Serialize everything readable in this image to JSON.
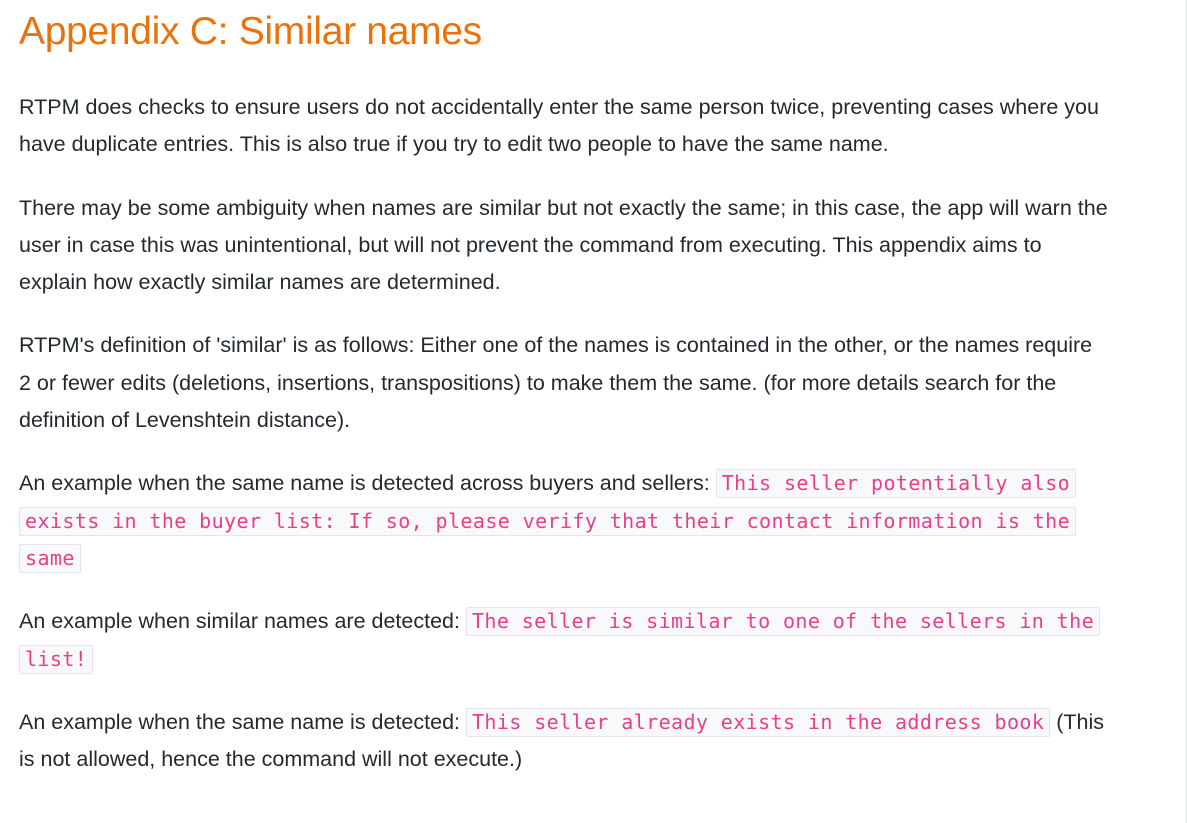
{
  "heading": "Appendix C: Similar names",
  "paragraphs": {
    "p1": "RTPM does checks to ensure users do not accidentally enter the same person twice, preventing cases where you have duplicate entries. This is also true if you try to edit two people to have the same name.",
    "p2": "There may be some ambiguity when names are similar but not exactly the same; in this case, the app will warn the user in case this was unintentional, but will not prevent the command from executing. This appendix aims to explain how exactly similar names are determined.",
    "p3": "RTPM's definition of 'similar' is as follows: Either one of the names is contained in the other, or the names require 2 or fewer edits (deletions, insertions, transpositions) to make them the same. (for more details search for the definition of Levenshtein distance).",
    "p4_prefix": "An example when the same name is detected across buyers and sellers: ",
    "p4_code": "This seller potentially also exists in the buyer list: If so, please verify that their contact information is the same",
    "p5_prefix": "An example when similar names are detected: ",
    "p5_code": "The seller is similar to one of the sellers in the list!",
    "p6_prefix": "An example when the same name is detected: ",
    "p6_code": "This seller already exists in the address book",
    "p6_suffix": " (This is not allowed, hence the command will not execute.)"
  }
}
